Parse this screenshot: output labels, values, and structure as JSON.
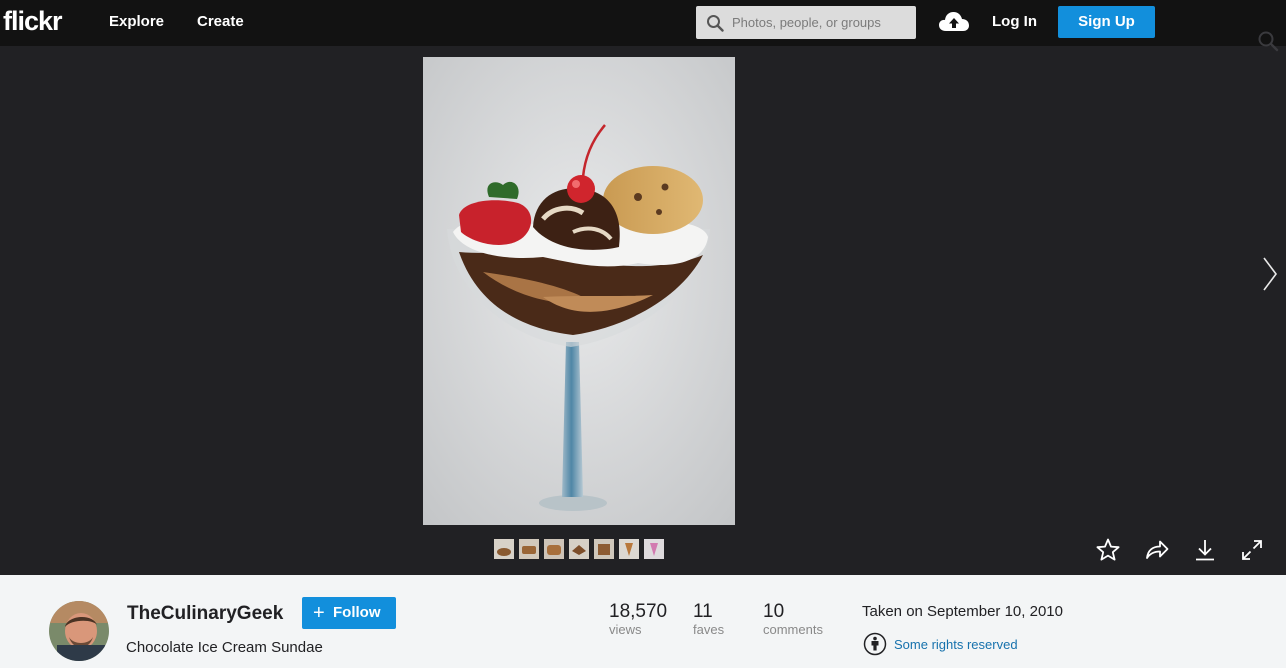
{
  "nav": {
    "logo": "flickr",
    "explore": "Explore",
    "create": "Create",
    "search_placeholder": "Photos, people, or groups",
    "login": "Log In",
    "signup": "Sign Up"
  },
  "photo": {
    "subject": "chocolate-ice-cream-sundae",
    "thumbnail_count": 7
  },
  "icons": {
    "search": "search-icon",
    "upload": "cloud-upload-icon",
    "next": "chevron-right-icon",
    "fave": "star-icon",
    "share": "share-arrow-icon",
    "download": "download-icon",
    "fullscreen": "expand-icon",
    "license": "creative-commons-icon"
  },
  "owner": {
    "name": "TheCulinaryGeek",
    "follow_label": "Follow",
    "follow_plus": "+"
  },
  "title": "Chocolate Ice Cream Sundae",
  "stats": [
    {
      "value": "18,570",
      "label": "views"
    },
    {
      "value": "11",
      "label": "faves"
    },
    {
      "value": "10",
      "label": "comments"
    }
  ],
  "taken": "Taken on September 10, 2010",
  "license": "Some rights reserved",
  "colors": {
    "topbar": "#121212",
    "stage": "#212124",
    "accent": "#128fdc",
    "info_bg": "#f3f5f6",
    "link": "#1772ad"
  }
}
